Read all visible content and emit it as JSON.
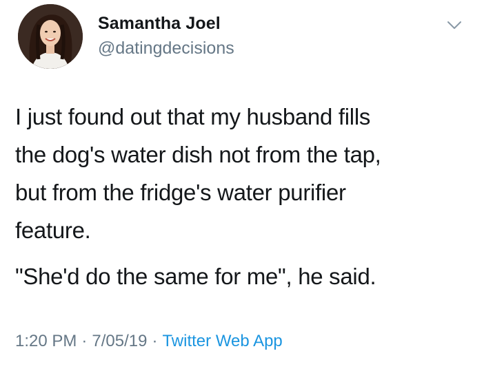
{
  "author": {
    "name": "Samantha Joel",
    "handle": "@datingdecisions"
  },
  "tweet": {
    "lines": [
      "I just found out that my husband fills\nthe dog's water dish not from the tap,\nbut from the fridge's water purifier\nfeature.",
      "\"She'd do the same for me\", he said."
    ]
  },
  "meta": {
    "time": "1:20 PM",
    "separator": "·",
    "date": "7/05/19",
    "source": "Twitter Web App"
  },
  "icons": {
    "menu": "chevron-down-icon"
  },
  "colors": {
    "text": "#14171a",
    "secondary": "#657786",
    "link": "#1b95e0"
  }
}
